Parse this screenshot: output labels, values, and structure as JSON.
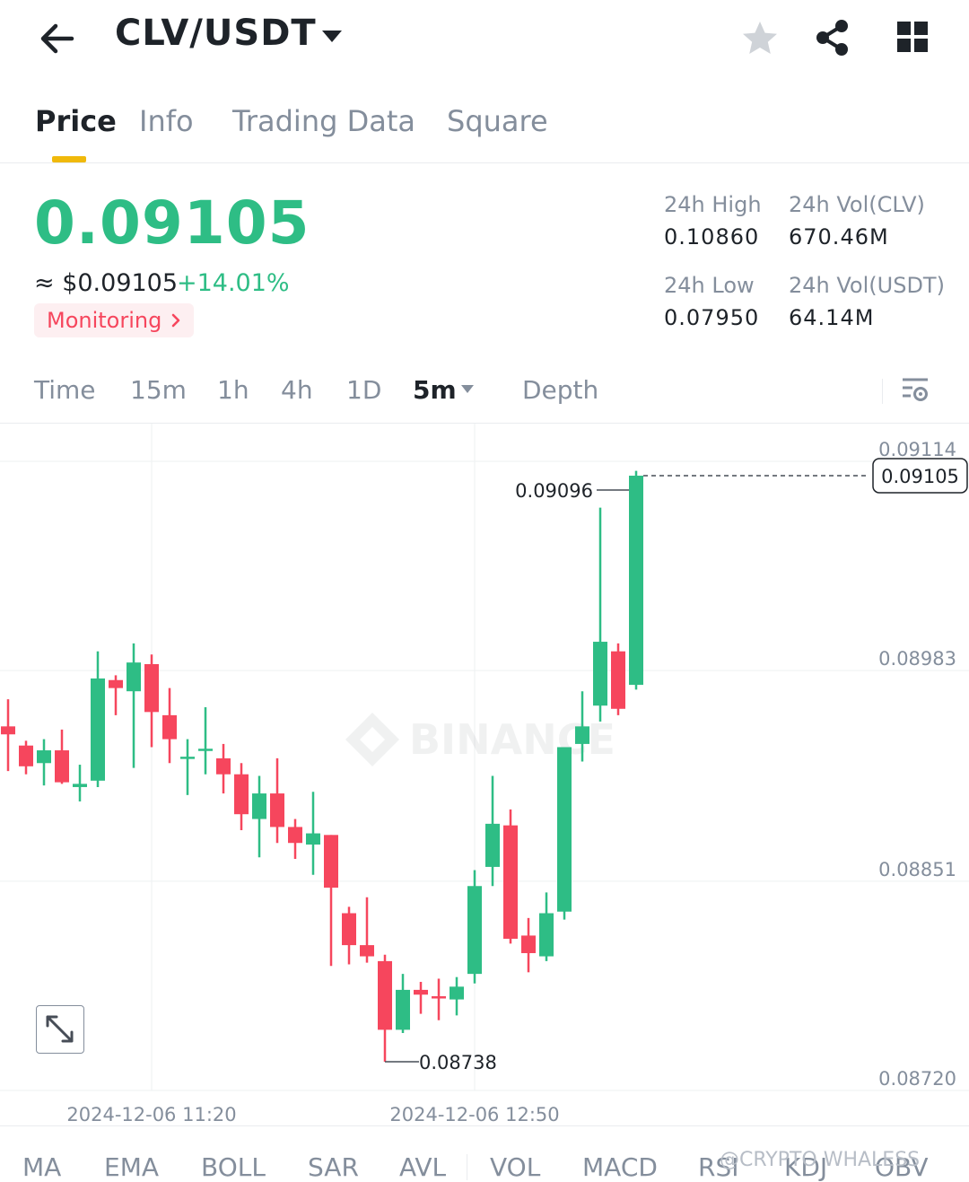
{
  "header": {
    "pair": "CLV/USDT",
    "icons": [
      "back-arrow-icon",
      "caret-down-icon",
      "star-icon",
      "share-icon",
      "grid-icon"
    ]
  },
  "tabs": [
    {
      "label": "Price",
      "active": true
    },
    {
      "label": "Info",
      "active": false
    },
    {
      "label": "Trading Data",
      "active": false
    },
    {
      "label": "Square",
      "active": false
    }
  ],
  "ticker": {
    "last_price": "0.09105",
    "fiat_price": "≈ $0.09105",
    "change_pct": "+14.01%",
    "monitoring_label": "Monitoring",
    "stats": {
      "high_label": "24h High",
      "high_value": "0.10860",
      "low_label": "24h Low",
      "low_value": "0.07950",
      "vol_base_label": "24h Vol(CLV)",
      "vol_base_value": "670.46M",
      "vol_quote_label": "24h Vol(USDT)",
      "vol_quote_value": "64.14M"
    }
  },
  "intervals": [
    {
      "label": "Time",
      "active": false
    },
    {
      "label": "15m",
      "active": false
    },
    {
      "label": "1h",
      "active": false
    },
    {
      "label": "4h",
      "active": false
    },
    {
      "label": "1D",
      "active": false
    },
    {
      "label": "5m",
      "active": true
    },
    {
      "label": "Depth",
      "active": false
    }
  ],
  "colors": {
    "up": "#2ebd85",
    "down": "#f6465d",
    "accent": "#f0b90b",
    "muted": "#848e9c"
  },
  "chart_data": {
    "type": "candlestick",
    "y_ticks": [
      "0.09114",
      "0.08983",
      "0.08851",
      "0.08720"
    ],
    "x_ticks": [
      "2024-12-06 11:20",
      "2024-12-06 12:50"
    ],
    "current_price_label": "0.09105",
    "max_label": "0.09096",
    "min_label": "0.08738",
    "watermark": "BINANCE",
    "candles": [
      {
        "o": 0.08948,
        "h": 0.08965,
        "l": 0.0892,
        "c": 0.08943
      },
      {
        "o": 0.08936,
        "h": 0.08939,
        "l": 0.08918,
        "c": 0.08923
      },
      {
        "o": 0.08925,
        "h": 0.0894,
        "l": 0.08911,
        "c": 0.08933
      },
      {
        "o": 0.08933,
        "h": 0.08946,
        "l": 0.08912,
        "c": 0.08913
      },
      {
        "o": 0.0891,
        "h": 0.08924,
        "l": 0.08901,
        "c": 0.08912
      },
      {
        "o": 0.08914,
        "h": 0.08995,
        "l": 0.0891,
        "c": 0.08978
      },
      {
        "o": 0.08977,
        "h": 0.0898,
        "l": 0.08955,
        "c": 0.08972
      },
      {
        "o": 0.0897,
        "h": 0.09,
        "l": 0.08922,
        "c": 0.08988
      },
      {
        "o": 0.08987,
        "h": 0.08993,
        "l": 0.08935,
        "c": 0.08957
      },
      {
        "o": 0.08955,
        "h": 0.08972,
        "l": 0.08925,
        "c": 0.0894
      },
      {
        "o": 0.08928,
        "h": 0.0894,
        "l": 0.08905,
        "c": 0.08929
      },
      {
        "o": 0.08933,
        "h": 0.0896,
        "l": 0.08918,
        "c": 0.08934
      },
      {
        "o": 0.08928,
        "h": 0.08937,
        "l": 0.08906,
        "c": 0.08918
      },
      {
        "o": 0.08918,
        "h": 0.08925,
        "l": 0.08883,
        "c": 0.08893
      },
      {
        "o": 0.0889,
        "h": 0.08917,
        "l": 0.08866,
        "c": 0.08906
      },
      {
        "o": 0.08906,
        "h": 0.08928,
        "l": 0.08875,
        "c": 0.08885
      },
      {
        "o": 0.08885,
        "h": 0.0889,
        "l": 0.08865,
        "c": 0.08875
      },
      {
        "o": 0.08874,
        "h": 0.08907,
        "l": 0.08855,
        "c": 0.08881
      },
      {
        "o": 0.0888,
        "h": 0.0888,
        "l": 0.08798,
        "c": 0.08847
      },
      {
        "o": 0.08831,
        "h": 0.08835,
        "l": 0.08799,
        "c": 0.08811
      },
      {
        "o": 0.08811,
        "h": 0.08841,
        "l": 0.088,
        "c": 0.08804
      },
      {
        "o": 0.08801,
        "h": 0.08805,
        "l": 0.08738,
        "c": 0.08758
      },
      {
        "o": 0.08758,
        "h": 0.08793,
        "l": 0.08756,
        "c": 0.08783
      },
      {
        "o": 0.08783,
        "h": 0.08788,
        "l": 0.08768,
        "c": 0.0878
      },
      {
        "o": 0.08779,
        "h": 0.0879,
        "l": 0.08764,
        "c": 0.08778
      },
      {
        "o": 0.08777,
        "h": 0.08791,
        "l": 0.08767,
        "c": 0.08785
      },
      {
        "o": 0.08793,
        "h": 0.08858,
        "l": 0.08787,
        "c": 0.08848
      },
      {
        "o": 0.0886,
        "h": 0.08917,
        "l": 0.08848,
        "c": 0.08887
      },
      {
        "o": 0.08886,
        "h": 0.08896,
        "l": 0.08812,
        "c": 0.08815
      },
      {
        "o": 0.08817,
        "h": 0.08828,
        "l": 0.08794,
        "c": 0.08806
      },
      {
        "o": 0.08804,
        "h": 0.08844,
        "l": 0.08801,
        "c": 0.08831
      },
      {
        "o": 0.08832,
        "h": 0.08935,
        "l": 0.08827,
        "c": 0.08935
      },
      {
        "o": 0.08937,
        "h": 0.0897,
        "l": 0.08926,
        "c": 0.08948
      },
      {
        "o": 0.08961,
        "h": 0.09085,
        "l": 0.08951,
        "c": 0.09001
      },
      {
        "o": 0.08995,
        "h": 0.09,
        "l": 0.08955,
        "c": 0.08959
      },
      {
        "o": 0.08974,
        "h": 0.09108,
        "l": 0.08971,
        "c": 0.09105
      }
    ]
  },
  "indicators": [
    "MA",
    "EMA",
    "BOLL",
    "SAR",
    "AVL",
    "VOL",
    "MACD",
    "RSI",
    "KDJ",
    "OBV"
  ],
  "watermark_handle": "@CRYPTO WHALESS"
}
